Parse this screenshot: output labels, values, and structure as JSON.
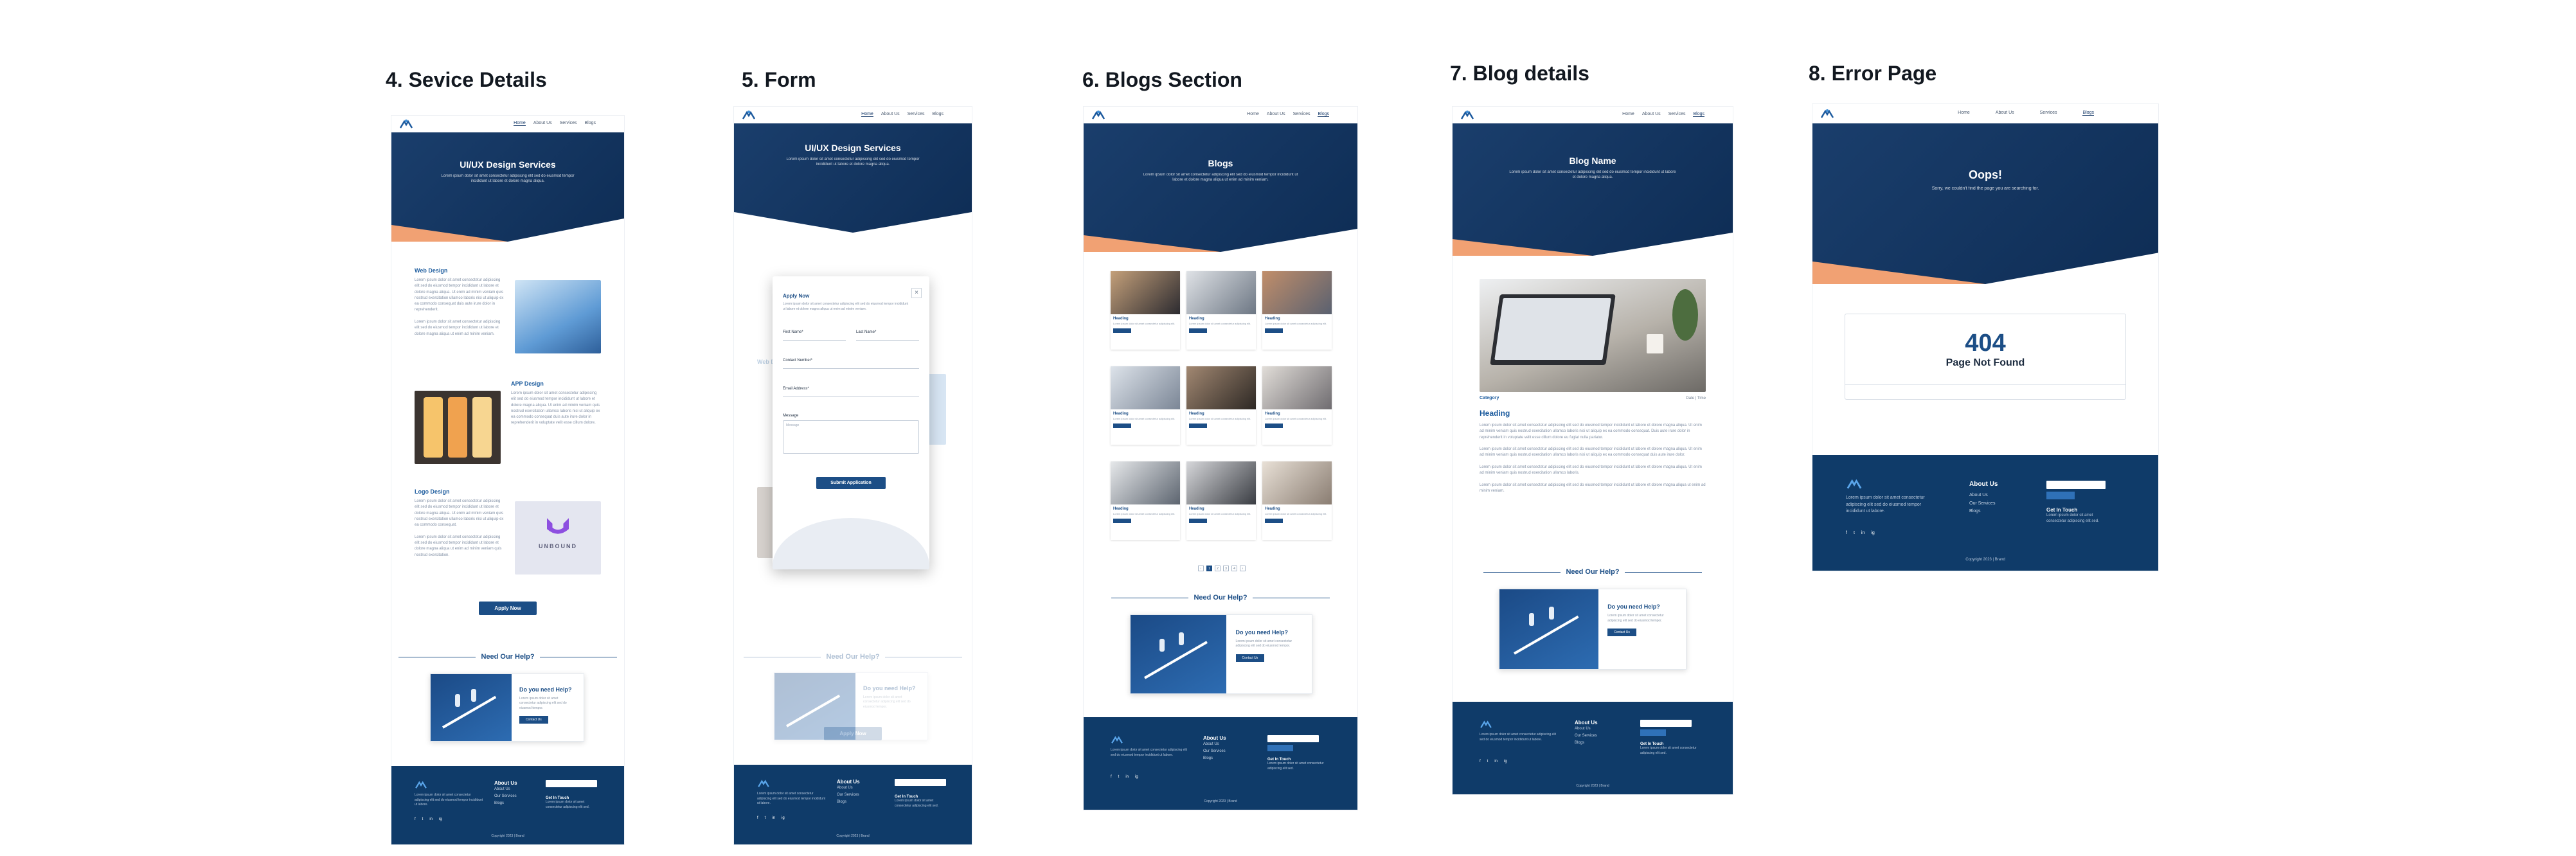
{
  "titles": [
    "4. Sevice Details",
    "5. Form",
    "6. Blogs Section",
    "7. Blog details",
    "8. Error Page"
  ],
  "nav": {
    "links": [
      "Home",
      "About Us",
      "Services",
      "Blogs"
    ]
  },
  "service": {
    "hero_title": "UI/UX Design Services",
    "hero_sub": "Lorem ipsum dolor sit amet consectetur adipiscing elit sed do eiusmod tempor incididunt ut labore et dolore magna aliqua.",
    "sections": [
      "Web Design",
      "APP Design",
      "Logo Design"
    ],
    "logo_word": "UNBOUND",
    "apply_label": "Apply Now"
  },
  "form": {
    "hero_title": "UI/UX Design Services",
    "bg_section": "Web Design",
    "modal_title": "Apply Now",
    "close": "×",
    "first_name": "First Name*",
    "last_name": "Last Name*",
    "contact": "Contact Number*",
    "email": "Email Address*",
    "message": "Message",
    "message_placeholder": "Message",
    "submit": "Submit Application",
    "apply_label": "Apply Now"
  },
  "blogs": {
    "hero_title": "Blogs",
    "hero_sub": "Lorem ipsum dolor sit amet consectetur adipiscing elit sed do eiusmod tempor incididunt ut labore et dolore magna aliqua ut enim ad minim veniam.",
    "card_heading": "Heading",
    "pages": [
      "‹",
      "1",
      "2",
      "3",
      "4",
      "›"
    ]
  },
  "blog_detail": {
    "hero_title": "Blog Name",
    "hero_sub": "Lorem ipsum dolor sit amet consectetur adipiscing elit sed do eiusmod tempor incididunt ut labore et dolore magna aliqua.",
    "category": "Category",
    "meta": "Date | Time",
    "heading": "Heading"
  },
  "error": {
    "hero_title": "Oops!",
    "hero_sub": "Sorry, we couldn't find the page you are searching for.",
    "code": "404",
    "msg": "Page Not Found"
  },
  "help": {
    "title": "Need Our Help?",
    "question": "Do you need Help?",
    "text": "Lorem ipsum dolor sit amet consectetur adipiscing elit sed do eiusmod tempor.",
    "button": "Contact Us"
  },
  "footer": {
    "about_title": "About Us",
    "links": [
      "About Us",
      "Our Services",
      "Blogs"
    ],
    "touch_title": "Get In Touch",
    "touch_text": "Lorem ipsum dolor sit amet consectetur adipiscing elit sed.",
    "desc": "Lorem ipsum dolor sit amet consectetur adipiscing elit sed do eiusmod tempor incididunt ut labore.",
    "social": [
      "f",
      "t",
      "in",
      "ig"
    ],
    "copyright": "Copyright 2023 | Brand"
  },
  "colors": {
    "primary": "#0f3b69",
    "accent": "#f1a173",
    "link": "#1d5c9e"
  }
}
